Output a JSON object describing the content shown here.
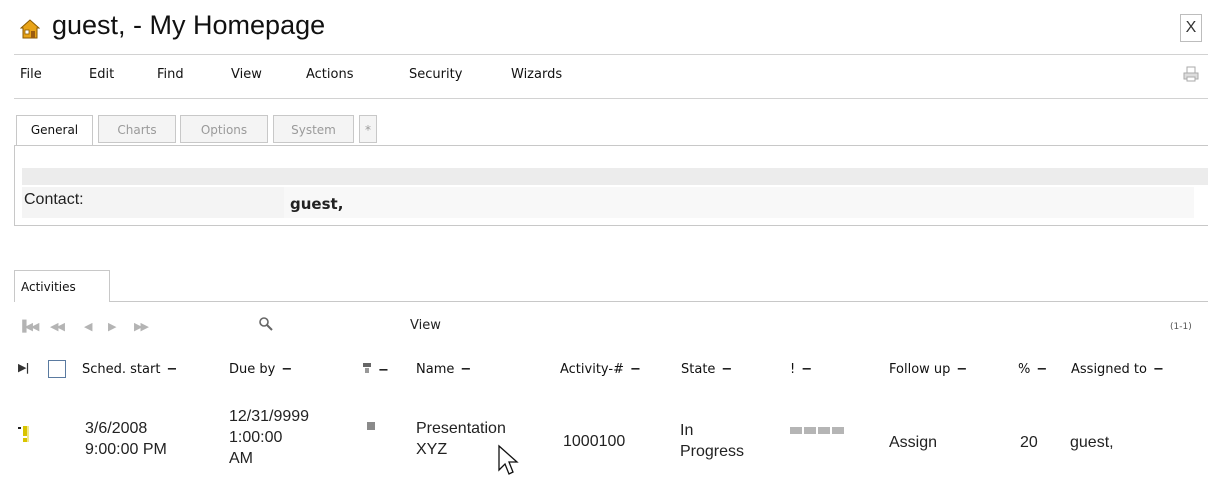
{
  "window": {
    "title": "guest, - My Homepage",
    "close_label": "X"
  },
  "menu": [
    "File",
    "Edit",
    "Find",
    "View",
    "Actions",
    "Security",
    "Wizards"
  ],
  "tabs": [
    "General",
    "Charts",
    "Options",
    "System",
    "*"
  ],
  "general": {
    "contact_label": "Contact:",
    "contact_value": "guest,"
  },
  "activities": {
    "tab_label": "Activities",
    "view_label": "View",
    "range": "(1-1)",
    "columns": [
      "Sched. start",
      "Due by",
      "",
      "Name",
      "Activity-#",
      "State",
      "!",
      "Follow up",
      "%",
      "Assigned to"
    ],
    "minus_glyph": "−",
    "rows": [
      {
        "sched_start": [
          "3/6/2008",
          "9:00:00 PM"
        ],
        "due_by": [
          "12/31/9999",
          "1:00:00",
          "AM"
        ],
        "name": [
          "Presentation",
          "XYZ"
        ],
        "activity_no": "1000100",
        "state": [
          "In",
          "Progress"
        ],
        "follow_up": "Assign",
        "percent": "20",
        "assigned_to": "guest,"
      }
    ]
  },
  "icons": {
    "home": "home-icon",
    "print": "printer-icon",
    "search": "search-icon",
    "priority": "priority-icon",
    "nav": [
      "first-page-icon",
      "previous-page-icon",
      "prev-icon",
      "next-icon",
      "last-page-icon"
    ]
  },
  "colors": {
    "home_icon": "#e8a317",
    "priority_icon": "#e0c800",
    "border": "#c8c8c8"
  }
}
